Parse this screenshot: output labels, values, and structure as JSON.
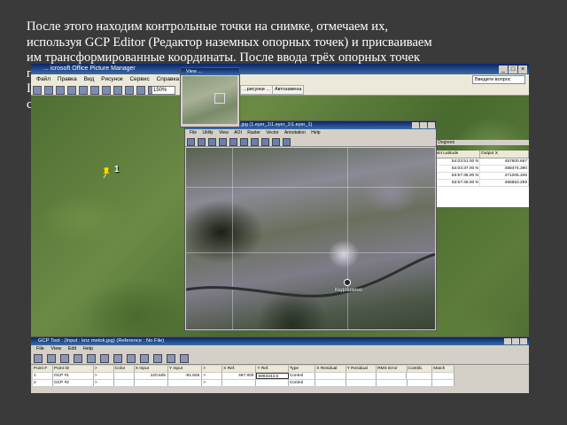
{
  "slide": {
    "text_lines": [
      "После этого находим контрольные точки на снимке, отмечаем их,",
      "используя GCP Editor (Редактор наземных опорных точек) и присваиваем",
      "им трансформированные координаты. После ввода трёх опорных точек",
      "п",
      "I",
      "с"
    ]
  },
  "office_picture_manager": {
    "title": "... icrosoft Office Picture Manager",
    "menu": [
      "Файл",
      "Правка",
      "Вид",
      "Рисунок",
      "Сервис",
      "Справка"
    ],
    "help_placeholder": "Введите вопрос",
    "zoom": "150%",
    "toolbar_buttons": [
      "...рисунки ...",
      "Автозамена"
    ],
    "pin_label": "1"
  },
  "view_window": {
    "title": "View ..."
  },
  "viewer": {
    "title": "Viewer #1 : knz metok.jpg (1.eyer_1\\1.eyer_1\\1.eyer_1)",
    "menu": [
      "File",
      "Utility",
      "View",
      "AOI",
      "Raster",
      "Vector",
      "Annotation",
      "Help"
    ],
    "town_label": "Кедошкино"
  },
  "right_panel": {
    "caption": "Tg Degrees",
    "headers": [
      "Point Latitude",
      "Output X"
    ],
    "rows": [
      [
        "54:03:51.00 N",
        "457600.667"
      ],
      [
        "54:03:37.00 N",
        "458474.390"
      ],
      [
        "53:57:36.00 N",
        "471205.326"
      ],
      [
        "53:57:48.00 N",
        "465653.259"
      ]
    ]
  },
  "gcp_tool": {
    "title": "GCP Tool : (Input : knz metok.jpg) (Reference : No File)",
    "menu": [
      "File",
      "View",
      "Edit",
      "Help"
    ],
    "headers": [
      "Point #",
      "Point ID",
      ">",
      "Color",
      "X Input",
      "Y Input",
      ">",
      "X Ref.",
      "Y Ref.",
      "Type",
      "X Residual",
      "Y Residual",
      "RMS Error",
      "Contrib.",
      "Match"
    ],
    "rows": [
      [
        "1",
        "GCP #1",
        ">",
        "",
        "120.625",
        "-91.625",
        ">",
        "467.000",
        "5993343.5",
        "Control",
        "",
        "",
        "",
        "",
        ""
      ],
      [
        "2",
        "GCP #2",
        ">",
        "",
        "",
        "",
        ">",
        "",
        "",
        "Control",
        "",
        "",
        "",
        "",
        ""
      ]
    ]
  }
}
